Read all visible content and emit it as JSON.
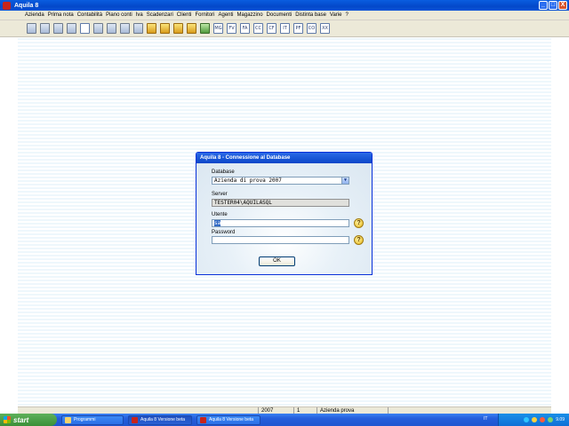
{
  "window": {
    "title": "Aquila 8",
    "buttons": [
      "_",
      "□",
      "X"
    ]
  },
  "menu": [
    "Azienda",
    "Prima nota",
    "Contabilità",
    "Piano conti",
    "Iva",
    "Scadenzari",
    "Clienti",
    "Fornitori",
    "Agenti",
    "Magazzino",
    "Documenti",
    "Distinta base",
    "Varie",
    "?"
  ],
  "toolbar": {
    "icons": [
      {
        "name": "azienda-icon",
        "style": ""
      },
      {
        "name": "copy-windows-icon",
        "style": ""
      },
      {
        "name": "calculator-icon",
        "style": ""
      },
      {
        "name": "grid-icon",
        "style": ""
      },
      {
        "name": "edit-pencil-icon",
        "style": "doc"
      },
      {
        "name": "table-icon",
        "style": ""
      },
      {
        "name": "book-icon",
        "style": ""
      },
      {
        "name": "tools-icon",
        "style": ""
      },
      {
        "name": "list-icon",
        "style": ""
      },
      {
        "name": "tag-icon",
        "style": "yellow"
      },
      {
        "name": "user-icon",
        "style": "yellow"
      },
      {
        "name": "box-icon",
        "style": "yellow"
      },
      {
        "name": "folder-icon",
        "style": "yellow"
      },
      {
        "name": "warehouse-icon",
        "style": "green"
      }
    ],
    "doc_buttons": [
      "MG",
      "FV",
      "FA",
      "CC",
      "CF",
      "IT",
      "PF",
      "CO",
      "XX"
    ]
  },
  "dialog": {
    "title": "Aquila 8  -  Connessione al Database",
    "database_label": "Database",
    "database_value": "Azienda di prova 2007",
    "server_label": "Server",
    "server_value": "TESTER04\\AQUILASQL",
    "user_label": "Utente",
    "user_value": "sa",
    "password_label": "Password",
    "password_value": "",
    "ok_label": "OK",
    "help_glyph": "?"
  },
  "statusbar": {
    "year": "2007",
    "number": "1",
    "company": "Azienda prova"
  },
  "taskbar": {
    "start_label": "start",
    "tasks": [
      {
        "label": "Programmi",
        "icon": "folder"
      },
      {
        "label": "Aquila 8  Versione beta",
        "icon": "app"
      },
      {
        "label": "Aquila 8  Versione beta",
        "icon": "app"
      }
    ],
    "language": "IT",
    "clock": "9.09"
  },
  "colors": {
    "titlebar": "#0a5de0",
    "taskbar": "#245edb",
    "start": "#3a8f37",
    "dialog_border": "#0831d9"
  }
}
